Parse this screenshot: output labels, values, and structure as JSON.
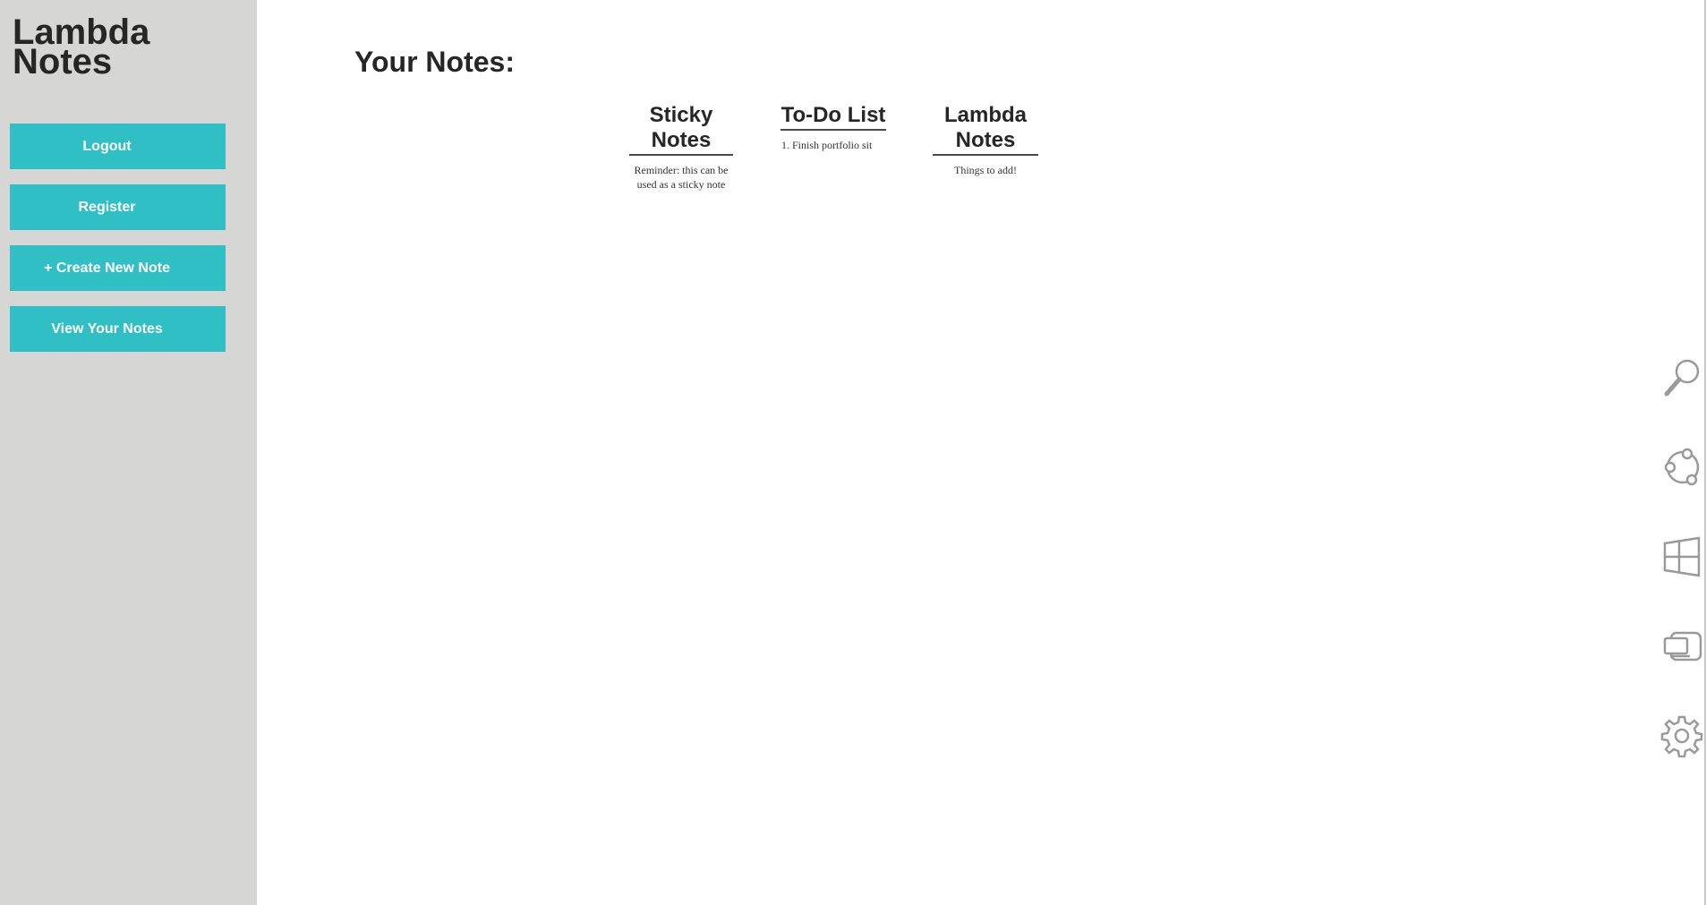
{
  "sidebar": {
    "app_title": "Lambda Notes",
    "buttons": [
      {
        "label": "Logout"
      },
      {
        "label": "Register"
      },
      {
        "label": "+ Create New Note"
      },
      {
        "label": "View Your Notes"
      }
    ]
  },
  "main": {
    "heading": "Your Notes:",
    "notes": [
      {
        "title": "Sticky Notes",
        "body": "Reminder: this can be used as a sticky note"
      },
      {
        "title": "To-Do List",
        "body": "1. Finish portfolio sit"
      },
      {
        "title": "Lambda Notes",
        "body": "Things to add!"
      }
    ]
  },
  "charms": [
    {
      "icon": "search-icon"
    },
    {
      "icon": "share-icon"
    },
    {
      "icon": "windows-start-icon"
    },
    {
      "icon": "devices-icon"
    },
    {
      "icon": "settings-gear-icon"
    }
  ],
  "colors": {
    "sidebar_bg": "#d6d6d4",
    "button_bg": "#2fbfc4",
    "button_text": "#ffffff",
    "heading_text": "#262626",
    "charm_icon": "#9a9a9a"
  }
}
